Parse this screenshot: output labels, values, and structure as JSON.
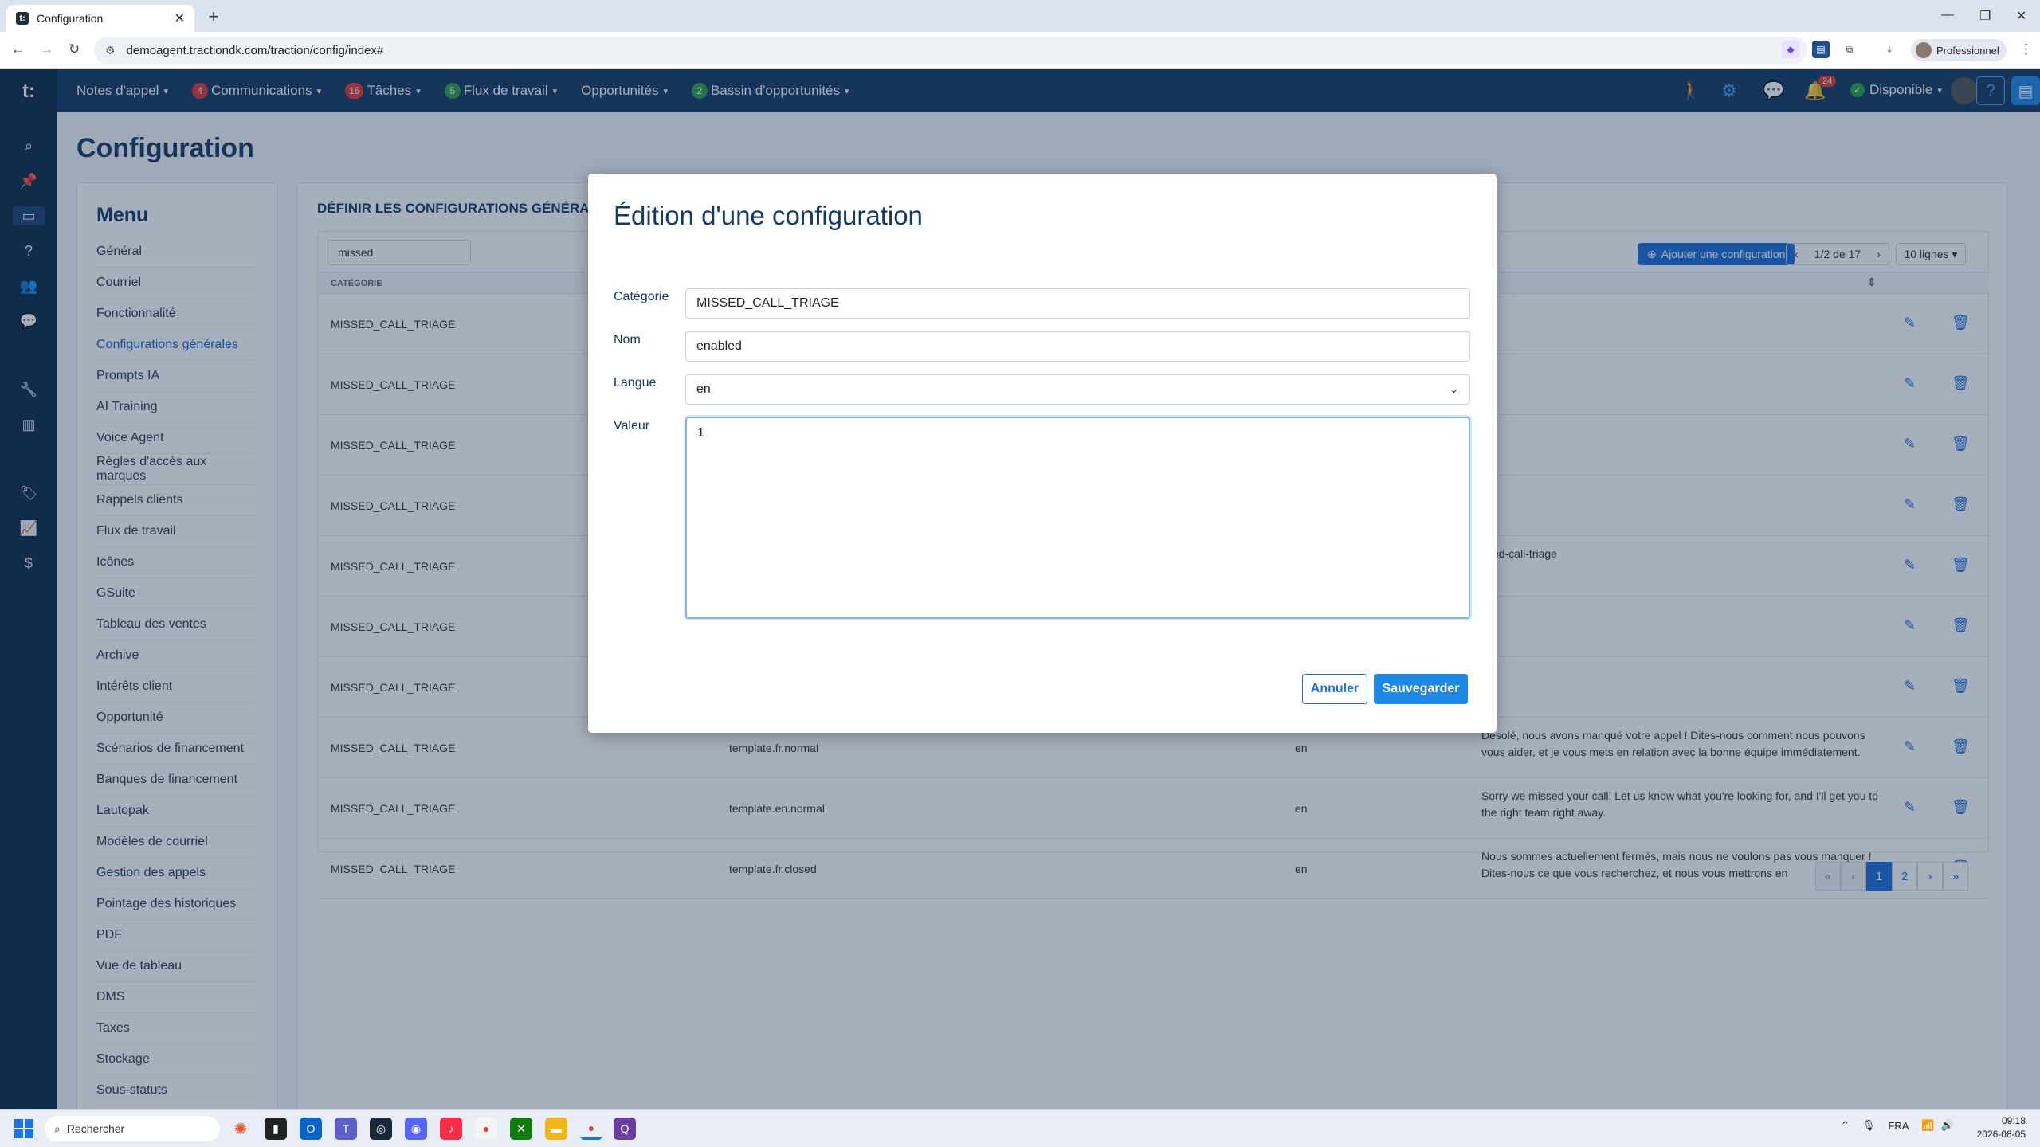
{
  "browser": {
    "tab_title": "Configuration",
    "url": "demoagent.tractiondk.com/traction/config/index#",
    "profile": "Professionnel"
  },
  "topnav": {
    "items": [
      {
        "label": "Notes d'appel",
        "badge": "",
        "badge_color": ""
      },
      {
        "label": "Communications",
        "badge": "4",
        "badge_color": "#e53935"
      },
      {
        "label": "Tâches",
        "badge": "16",
        "badge_color": "#e53935"
      },
      {
        "label": "Flux de travail",
        "badge": "5",
        "badge_color": "#2e9e4a"
      },
      {
        "label": "Opportunités",
        "badge": "",
        "badge_color": ""
      },
      {
        "label": "Bassin d'opportunités",
        "badge": "2",
        "badge_color": "#2e9e4a"
      }
    ],
    "notif_count": "24",
    "status": "Disponible",
    "help": "?"
  },
  "page": {
    "title": "Configuration"
  },
  "menu": {
    "title": "Menu",
    "items": [
      "Général",
      "Courriel",
      "Fonctionnalité",
      "Configurations générales",
      "Prompts IA",
      "AI Training",
      "Voice Agent",
      "Règles d'accès aux marques",
      "Rappels clients",
      "Flux de travail",
      "Icônes",
      "GSuite",
      "Tableau des ventes",
      "Archive",
      "Intérêts client",
      "Opportunité",
      "Scénarios de financement",
      "Banques de financement",
      "Lautopak",
      "Modèles de courriel",
      "Gestion des appels",
      "Pointage des historiques",
      "PDF",
      "Vue de tableau",
      "DMS",
      "Taxes",
      "Stockage",
      "Sous-statuts"
    ],
    "active_index": 3
  },
  "content": {
    "section_title": "DÉFINIR LES CONFIGURATIONS GÉNÉRAL",
    "filter_value": "missed",
    "add_button": "Ajouter une configuration",
    "page_counter": "1/2 de 17",
    "lines_select": "10 lignes",
    "headers": {
      "category": "CATÉGORIE",
      "value": "UR"
    },
    "rows": [
      {
        "category": "MISSED_CALL_TRIAGE",
        "name": "",
        "lang": "",
        "value": ""
      },
      {
        "category": "MISSED_CALL_TRIAGE",
        "name": "",
        "lang": "",
        "value": ""
      },
      {
        "category": "MISSED_CALL_TRIAGE",
        "name": "",
        "lang": "",
        "value": ""
      },
      {
        "category": "MISSED_CALL_TRIAGE",
        "name": "",
        "lang": "",
        "value": ""
      },
      {
        "category": "MISSED_CALL_TRIAGE",
        "name": "",
        "lang": "",
        "value": "ssed-call-triage"
      },
      {
        "category": "MISSED_CALL_TRIAGE",
        "name": "",
        "lang": "",
        "value": ""
      },
      {
        "category": "MISSED_CALL_TRIAGE",
        "name": "",
        "lang": "",
        "value": ""
      },
      {
        "category": "MISSED_CALL_TRIAGE",
        "name": "template.fr.normal",
        "lang": "en",
        "value": "Désolé, nous avons manqué votre appel ! Dites-nous comment nous pouvons vous aider, et je vous mets en relation avec la bonne équipe immédiatement."
      },
      {
        "category": "MISSED_CALL_TRIAGE",
        "name": "template.en.normal",
        "lang": "en",
        "value": "Sorry we missed your call! Let us know what you're looking for, and I'll get you to the right team right away."
      },
      {
        "category": "MISSED_CALL_TRIAGE",
        "name": "template.fr.closed",
        "lang": "en",
        "value": "Nous sommes actuellement fermés, mais nous ne voulons pas vous manquer ! Dites-nous ce que vous recherchez, et nous vous mettrons en"
      }
    ],
    "pager": [
      "«",
      "‹",
      "1",
      "2",
      "›",
      "»"
    ]
  },
  "modal": {
    "title": "Édition d'une configuration",
    "category_label": "Catégorie",
    "category_value": "MISSED_CALL_TRIAGE",
    "name_label": "Nom",
    "name_value": "enabled",
    "lang_label": "Langue",
    "lang_value": "en",
    "value_label": "Valeur",
    "value_value": "1",
    "cancel": "Annuler",
    "save": "Sauvegarder"
  },
  "taskbar": {
    "search": "Rechercher",
    "lang": "FRA",
    "time": "09:18",
    "date": "2026-08-05"
  }
}
